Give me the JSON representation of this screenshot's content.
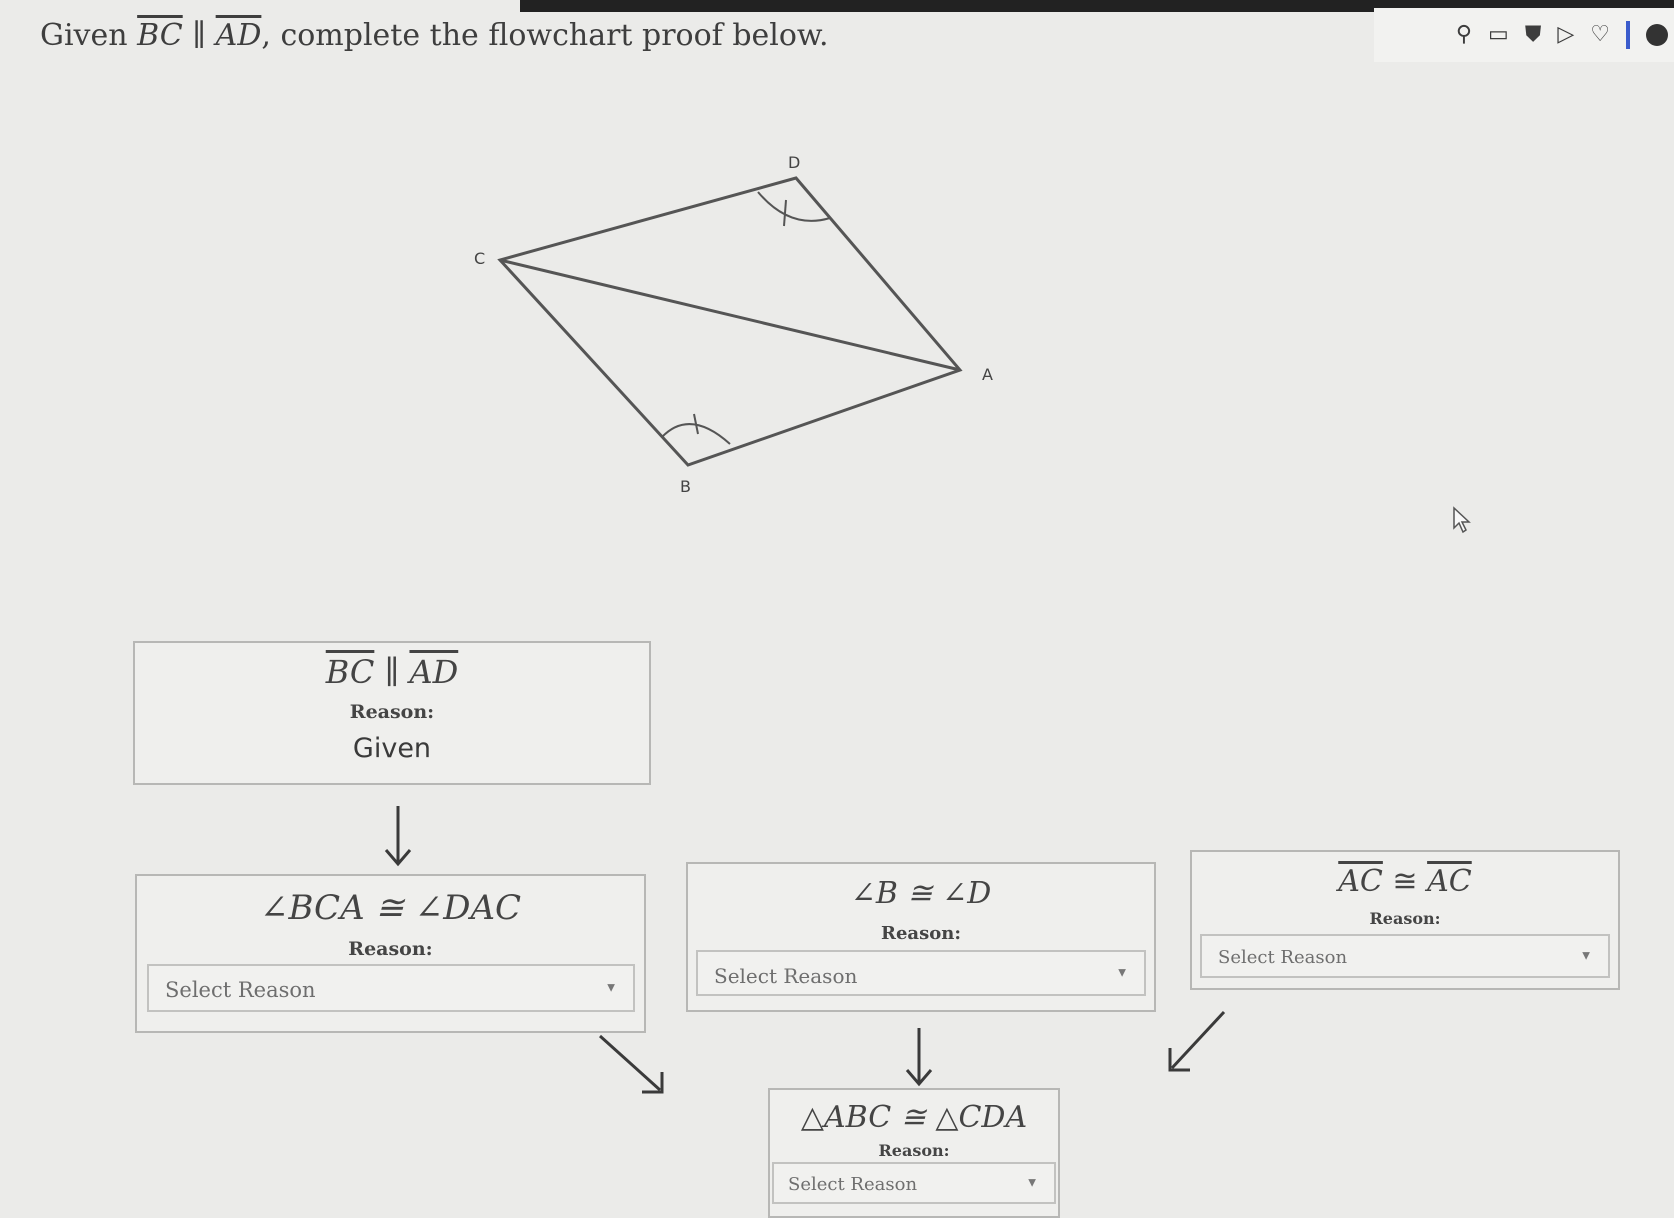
{
  "prompt": {
    "given_word": "Given",
    "seg1": "BC",
    "parallel": "∥",
    "seg2": "AD",
    "rest": ", complete the flowchart proof below."
  },
  "diagram": {
    "labels": {
      "D": "D",
      "C": "C",
      "A": "A",
      "B": "B"
    }
  },
  "proof": {
    "box_given": {
      "statement_seg1": "BC",
      "statement_sym": "∥",
      "statement_seg2": "AD",
      "reason_label": "Reason:",
      "reason_value": "Given"
    },
    "box_angles": {
      "statement": "∠BCA ≅ ∠DAC",
      "reason_label": "Reason:",
      "select_placeholder": "Select Reason"
    },
    "box_bd": {
      "statement": "∠B ≅ ∠D",
      "reason_label": "Reason:",
      "select_placeholder": "Select Reason"
    },
    "box_ac": {
      "statement_seg1": "AC",
      "statement_sym": "≅",
      "statement_seg2": "AC",
      "reason_label": "Reason:",
      "select_placeholder": "Select Reason"
    },
    "box_triangles": {
      "statement": "△ABC ≅ △CDA",
      "reason_label": "Reason:",
      "select_placeholder": "Select Reason"
    }
  },
  "toolbar": {
    "icons": [
      "pin-icon",
      "bookmark-icon",
      "shield-icon",
      "play-icon",
      "heart-icon",
      "profile-icon"
    ]
  }
}
